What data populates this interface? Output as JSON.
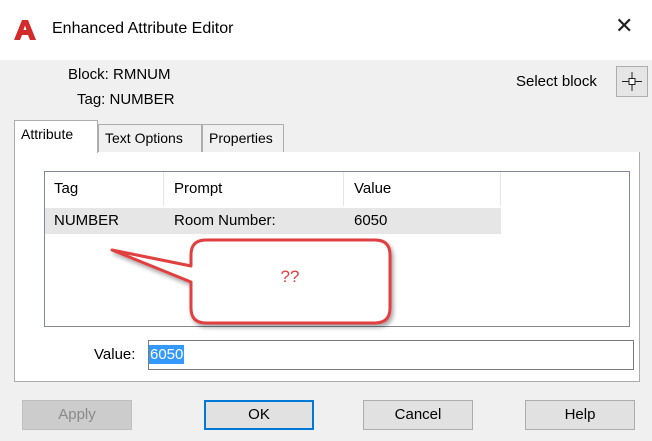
{
  "window": {
    "title": "Enhanced Attribute Editor",
    "close_glyph": "✕"
  },
  "header": {
    "block_label": "Block: RMNUM",
    "tag_label": "Tag: NUMBER",
    "select_block_label": "Select block"
  },
  "tabs": [
    {
      "label": "Attribute",
      "active": true
    },
    {
      "label": "Text Options",
      "active": false
    },
    {
      "label": "Properties",
      "active": false
    }
  ],
  "table": {
    "columns": [
      "Tag",
      "Prompt",
      "Value"
    ],
    "rows": [
      {
        "tag": "NUMBER",
        "prompt": "Room Number:",
        "value": "6050"
      }
    ]
  },
  "callout": {
    "text": "??",
    "color": "#e04040"
  },
  "value_field": {
    "label": "Value:",
    "value": "6050"
  },
  "buttons": {
    "apply": "Apply",
    "ok": "OK",
    "cancel": "Cancel",
    "help": "Help"
  },
  "colors": {
    "accent": "#0078d7",
    "selection": "#3399ff",
    "app_icon": "#d32a2a"
  }
}
